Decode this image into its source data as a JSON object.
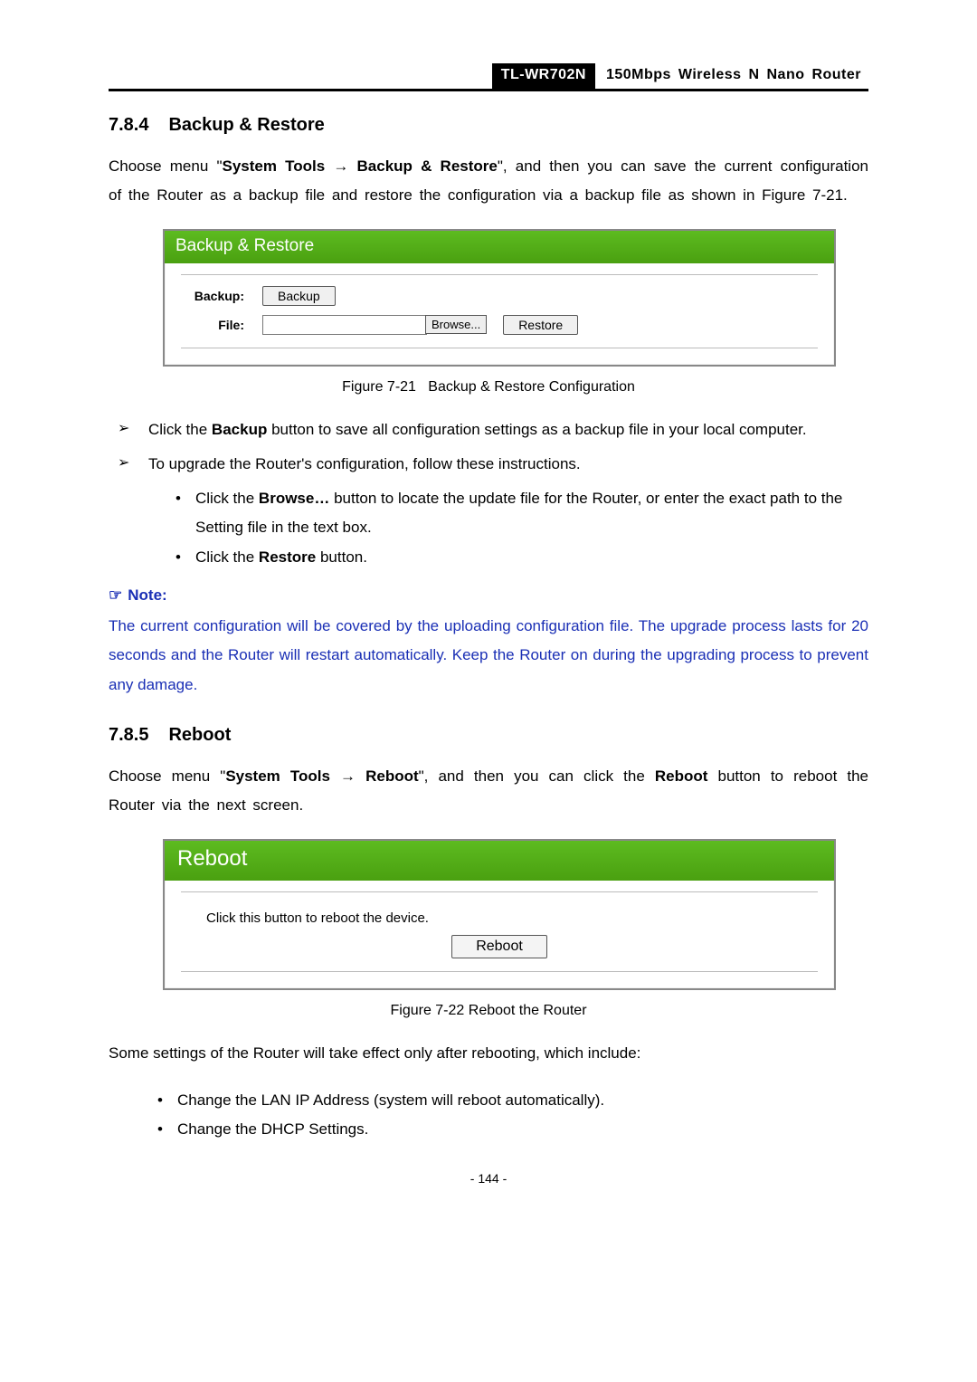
{
  "header": {
    "model": "TL-WR702N",
    "product": "150Mbps Wireless N Nano Router"
  },
  "sections": {
    "backup_restore": {
      "number": "7.8.4",
      "title": "Backup & Restore",
      "intro_pre": "Choose menu \"",
      "intro_bold1": "System Tools",
      "intro_arrow": " → ",
      "intro_bold2": "Backup & Restore",
      "intro_post": "\", and then you can save the current configuration of the Router as a backup file and restore the configuration via a backup file as shown in Figure 7-21."
    },
    "reboot": {
      "number": "7.8.5",
      "title": "Reboot",
      "intro_pre": "Choose menu \"",
      "intro_bold1": "System Tools",
      "intro_arrow": " → ",
      "intro_bold2": "Reboot",
      "intro_mid": "\", and then you can click the ",
      "intro_bold3": "Reboot",
      "intro_post": " button to reboot the Router via the next screen."
    }
  },
  "figures": {
    "f721": {
      "caption_label": "Figure 7-21",
      "caption_text": "Backup & Restore Configuration",
      "panel_title": "Backup & Restore",
      "backup_label": "Backup:",
      "backup_button": "Backup",
      "file_label": "File:",
      "browse_button": "Browse...",
      "restore_button": "Restore"
    },
    "f722": {
      "caption_label": "Figure 7-22",
      "caption_text": "Reboot the Router",
      "panel_title": "Reboot",
      "hint": "Click this button to reboot the device.",
      "reboot_button": "Reboot"
    }
  },
  "bullets": {
    "b1_pre": "Click the ",
    "b1_bold": "Backup",
    "b1_post": " button to save all configuration settings as a backup file in your local computer.",
    "b2": "To upgrade the Router's configuration, follow these instructions.",
    "b2a_pre": "Click the ",
    "b2a_bold": "Browse…",
    "b2a_post": " button to locate the update file for the Router, or enter the exact path to the Setting file in the text box.",
    "b2b_pre": "Click the ",
    "b2b_bold": "Restore",
    "b2b_post": " button.",
    "after_reboot_intro": "Some settings of the Router will take effect only after rebooting, which include:",
    "r1": "Change the LAN IP Address (system will reboot automatically).",
    "r2": "Change the DHCP Settings."
  },
  "note": {
    "label": "Note:",
    "body": "The current configuration will be covered by the uploading configuration file. The upgrade process lasts for 20 seconds and the Router will restart automatically. Keep the Router on during the upgrading process to prevent any damage."
  },
  "page_number": "- 144 -"
}
